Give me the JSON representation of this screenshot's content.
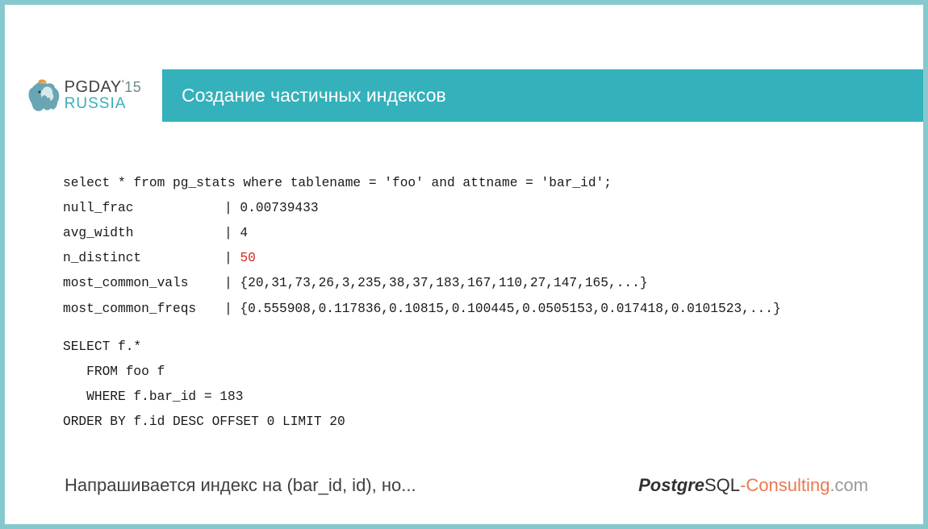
{
  "logo": {
    "line1a": "PGDAY",
    "apos": "'",
    "year": "15",
    "line2": "RUSSIA"
  },
  "title": "Создание частичных индексов",
  "code": {
    "l1": "select * from pg_stats where tablename = 'foo' and attname = 'bar_id';",
    "l2a": "null_frac",
    "l2b": "| 0.00739433",
    "l3a": "avg_width",
    "l3b": "| 4",
    "l4a": "n_distinct",
    "l4b": "| ",
    "l4c": "50",
    "l5a": "most_common_vals",
    "l5b": "| {20,31,73,26,3,235,38,37,183,167,110,27,147,165,...}",
    "l6a": "most_common_freqs",
    "l6b": "| {0.555908,0.117836,0.10815,0.100445,0.0505153,0.017418,0.0101523,...}",
    "l7": "SELECT f.*",
    "l8": "   FROM foo f",
    "l9": "   WHERE f.bar_id = 183",
    "l10": "ORDER BY f.id DESC OFFSET 0 LIMIT 20"
  },
  "note": "Напрашивается индекс на (bar_id, id), но...",
  "brand": {
    "p1": "Postgre",
    "p2": "SQL",
    "dash": "-",
    "p3": "Consulting",
    "p4": ".com"
  }
}
